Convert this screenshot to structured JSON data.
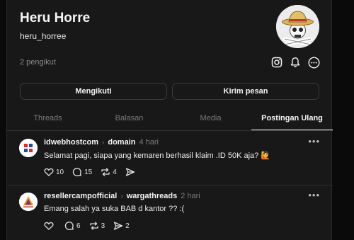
{
  "profile": {
    "name": "Heru Horre",
    "handle": "heru_horree",
    "followers": "2 pengikut"
  },
  "buttons": {
    "follow": "Mengikuti",
    "message": "Kirim pesan"
  },
  "tabs": [
    "Threads",
    "Balasan",
    "Media",
    "Postingan Ulang"
  ],
  "active_tab": "Postingan Ulang",
  "posts": [
    {
      "author": "idwebhostcom",
      "community": "domain",
      "time": "4 hari",
      "text": "Selamat pagi, siapa yang kemaren berhasil klaim .ID 50K aja? 🙋",
      "likes": "10",
      "replies": "15",
      "reposts": "4",
      "shares": ""
    },
    {
      "author": "resellercampofficial",
      "community": "wargathreads",
      "time": "2 hari",
      "text": "Emang salah ya suka BAB d kantor ?? :(",
      "likes": "",
      "replies": "6",
      "reposts": "3",
      "shares": "2"
    }
  ],
  "icons": [
    "instagram-icon",
    "bell-icon",
    "more-icon"
  ],
  "colors": {
    "background": "#181818",
    "text": "#f3f5f7",
    "muted": "#7a7a7a",
    "border": "#3a3a3a"
  }
}
